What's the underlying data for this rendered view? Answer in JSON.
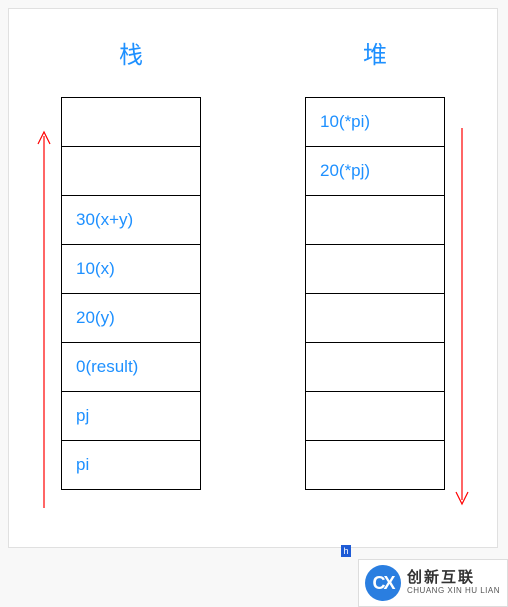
{
  "stack": {
    "title": "栈",
    "cells": [
      "",
      "",
      "30(x+y)",
      "10(x)",
      "20(y)",
      "0(result)",
      "pj",
      "pi"
    ],
    "arrow_direction": "up"
  },
  "heap": {
    "title": "堆",
    "cells": [
      "10(*pi)",
      "20(*pj)",
      "",
      "",
      "",
      "",
      "",
      ""
    ],
    "arrow_direction": "down"
  },
  "brand": {
    "logo_text": "CX",
    "name_cn": "创新互联",
    "name_en": "CHUANG XIN HU LIAN"
  },
  "marker": "h",
  "colors": {
    "accent": "#1e90ff",
    "arrow": "#ff0000"
  },
  "chart_data": {
    "type": "table",
    "title": "",
    "series": [
      {
        "name": "栈",
        "values": [
          "",
          "",
          "30(x+y)",
          "10(x)",
          "20(y)",
          "0(result)",
          "pj",
          "pi"
        ],
        "grow": "up"
      },
      {
        "name": "堆",
        "values": [
          "10(*pi)",
          "20(*pj)",
          "",
          "",
          "",
          "",
          "",
          ""
        ],
        "grow": "down"
      }
    ]
  }
}
